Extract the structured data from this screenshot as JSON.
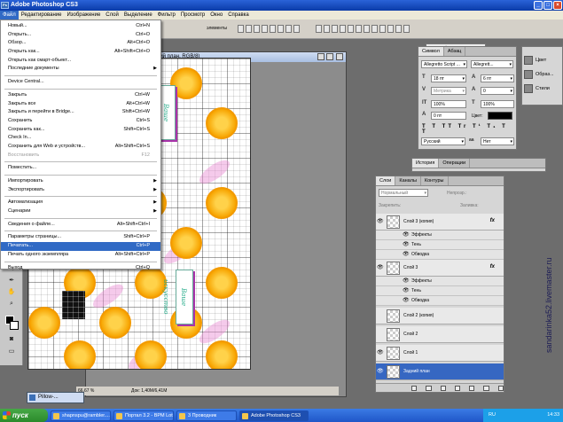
{
  "window": {
    "title": "Adobe Photoshop CS3",
    "app_icon": "Ps"
  },
  "menubar": [
    "Файл",
    "Редактирование",
    "Изображение",
    "Слой",
    "Выделение",
    "Фильтр",
    "Просмотр",
    "Окно",
    "Справка"
  ],
  "options_bar": {
    "workspace": "Рабочая среда ▾",
    "auto_label": "элементы"
  },
  "file_menu": [
    {
      "label": "Новый...",
      "shortcut": "Ctrl+N"
    },
    {
      "label": "Открыть...",
      "shortcut": "Ctrl+O"
    },
    {
      "label": "Обзор...",
      "shortcut": "Alt+Ctrl+O"
    },
    {
      "label": "Открыть как...",
      "shortcut": "Alt+Shift+Ctrl+O"
    },
    {
      "label": "Открыть как смарт-объект...",
      "shortcut": ""
    },
    {
      "label": "Последние документы",
      "shortcut": "",
      "submenu": true
    },
    {
      "sep": true
    },
    {
      "label": "Device Central...",
      "shortcut": ""
    },
    {
      "sep": true
    },
    {
      "label": "Закрыть",
      "shortcut": "Ctrl+W"
    },
    {
      "label": "Закрыть все",
      "shortcut": "Alt+Ctrl+W"
    },
    {
      "label": "Закрыть и перейти в Bridge...",
      "shortcut": "Shift+Ctrl+W"
    },
    {
      "label": "Сохранить",
      "shortcut": "Ctrl+S"
    },
    {
      "label": "Сохранить как...",
      "shortcut": "Shift+Ctrl+S"
    },
    {
      "label": "Check In...",
      "shortcut": ""
    },
    {
      "label": "Сохранить для Web и устройств...",
      "shortcut": "Alt+Shift+Ctrl+S"
    },
    {
      "label": "Восстановить",
      "shortcut": "F12",
      "disabled": true
    },
    {
      "sep": true
    },
    {
      "label": "Поместить...",
      "shortcut": ""
    },
    {
      "sep": true
    },
    {
      "label": "Импортировать",
      "shortcut": "",
      "submenu": true
    },
    {
      "label": "Экспортировать",
      "shortcut": "",
      "submenu": true
    },
    {
      "sep": true
    },
    {
      "label": "Автоматизация",
      "shortcut": "",
      "submenu": true
    },
    {
      "label": "Сценарии",
      "shortcut": "",
      "submenu": true
    },
    {
      "sep": true
    },
    {
      "label": "Сведения о файле...",
      "shortcut": "Alt+Shift+Ctrl+I"
    },
    {
      "sep": true
    },
    {
      "label": "Параметры страницы...",
      "shortcut": "Shift+Ctrl+P"
    },
    {
      "label": "Печатать...",
      "shortcut": "Ctrl+P",
      "highlighted": true
    },
    {
      "label": "Печать одного экземпляра",
      "shortcut": "Alt+Shift+Ctrl+P"
    },
    {
      "sep": true
    },
    {
      "label": "Выход",
      "shortcut": "Ctrl+Q"
    }
  ],
  "document": {
    "title": "ний план, RGB/8)",
    "zoom": "66,67 %",
    "doc_info": "Док: 1,40M/6,41M",
    "tag_text": "Ваше искусство"
  },
  "character_panel": {
    "tabs": [
      "Символ",
      "Абзац"
    ],
    "font": "Allegretto Script ...",
    "style": "Allegrett...",
    "size": "18 пт",
    "leading": "6 пт",
    "kerning": "Метрика",
    "tracking": "0",
    "vscale": "100%",
    "hscale": "100%",
    "baseline": "0 пт",
    "color_label": "Цвет:",
    "language": "Русский",
    "aa": "Нет"
  },
  "style_panel": [
    "Цвет",
    "Образ...",
    "Стили"
  ],
  "history_panel": {
    "tabs": [
      "История",
      "Операции"
    ]
  },
  "layers_panel": {
    "tabs": [
      "Слои",
      "Каналы",
      "Контуры"
    ],
    "blend_mode": "Нормальный",
    "opacity_label": "Непрозр.:",
    "lock_label": "Закрепить:",
    "fill_label": "Заливка:",
    "layers": [
      {
        "name": "Слой 3 (копия)",
        "fx": true,
        "eye": true
      },
      {
        "name": "Эффекты",
        "sub": true
      },
      {
        "name": "Тень",
        "sub": true
      },
      {
        "name": "Обводка",
        "sub": true
      },
      {
        "name": "Слой 3",
        "fx": true,
        "eye": true
      },
      {
        "name": "Эффекты",
        "sub": true
      },
      {
        "name": "Тень",
        "sub": true
      },
      {
        "name": "Обводка",
        "sub": true
      },
      {
        "name": "Слой 2 (копия)",
        "eye": false
      },
      {
        "name": "Слой 2",
        "eye": false
      },
      {
        "name": "Слой 1",
        "eye": true
      },
      {
        "name": "Задний план",
        "eye": true,
        "selected": true
      }
    ]
  },
  "minimized_doc": "Pillow-...",
  "taskbar": {
    "start": "пуск",
    "items": [
      "shapnspu@rambler....",
      "Портал 3.2 - ВРМ Lot...",
      "3 Проводник",
      "Adobe Photoshop CS3"
    ],
    "active_index": 3,
    "lang": "RU",
    "time": "14:33"
  },
  "watermark": "sandarinka52.livemaster.ru"
}
